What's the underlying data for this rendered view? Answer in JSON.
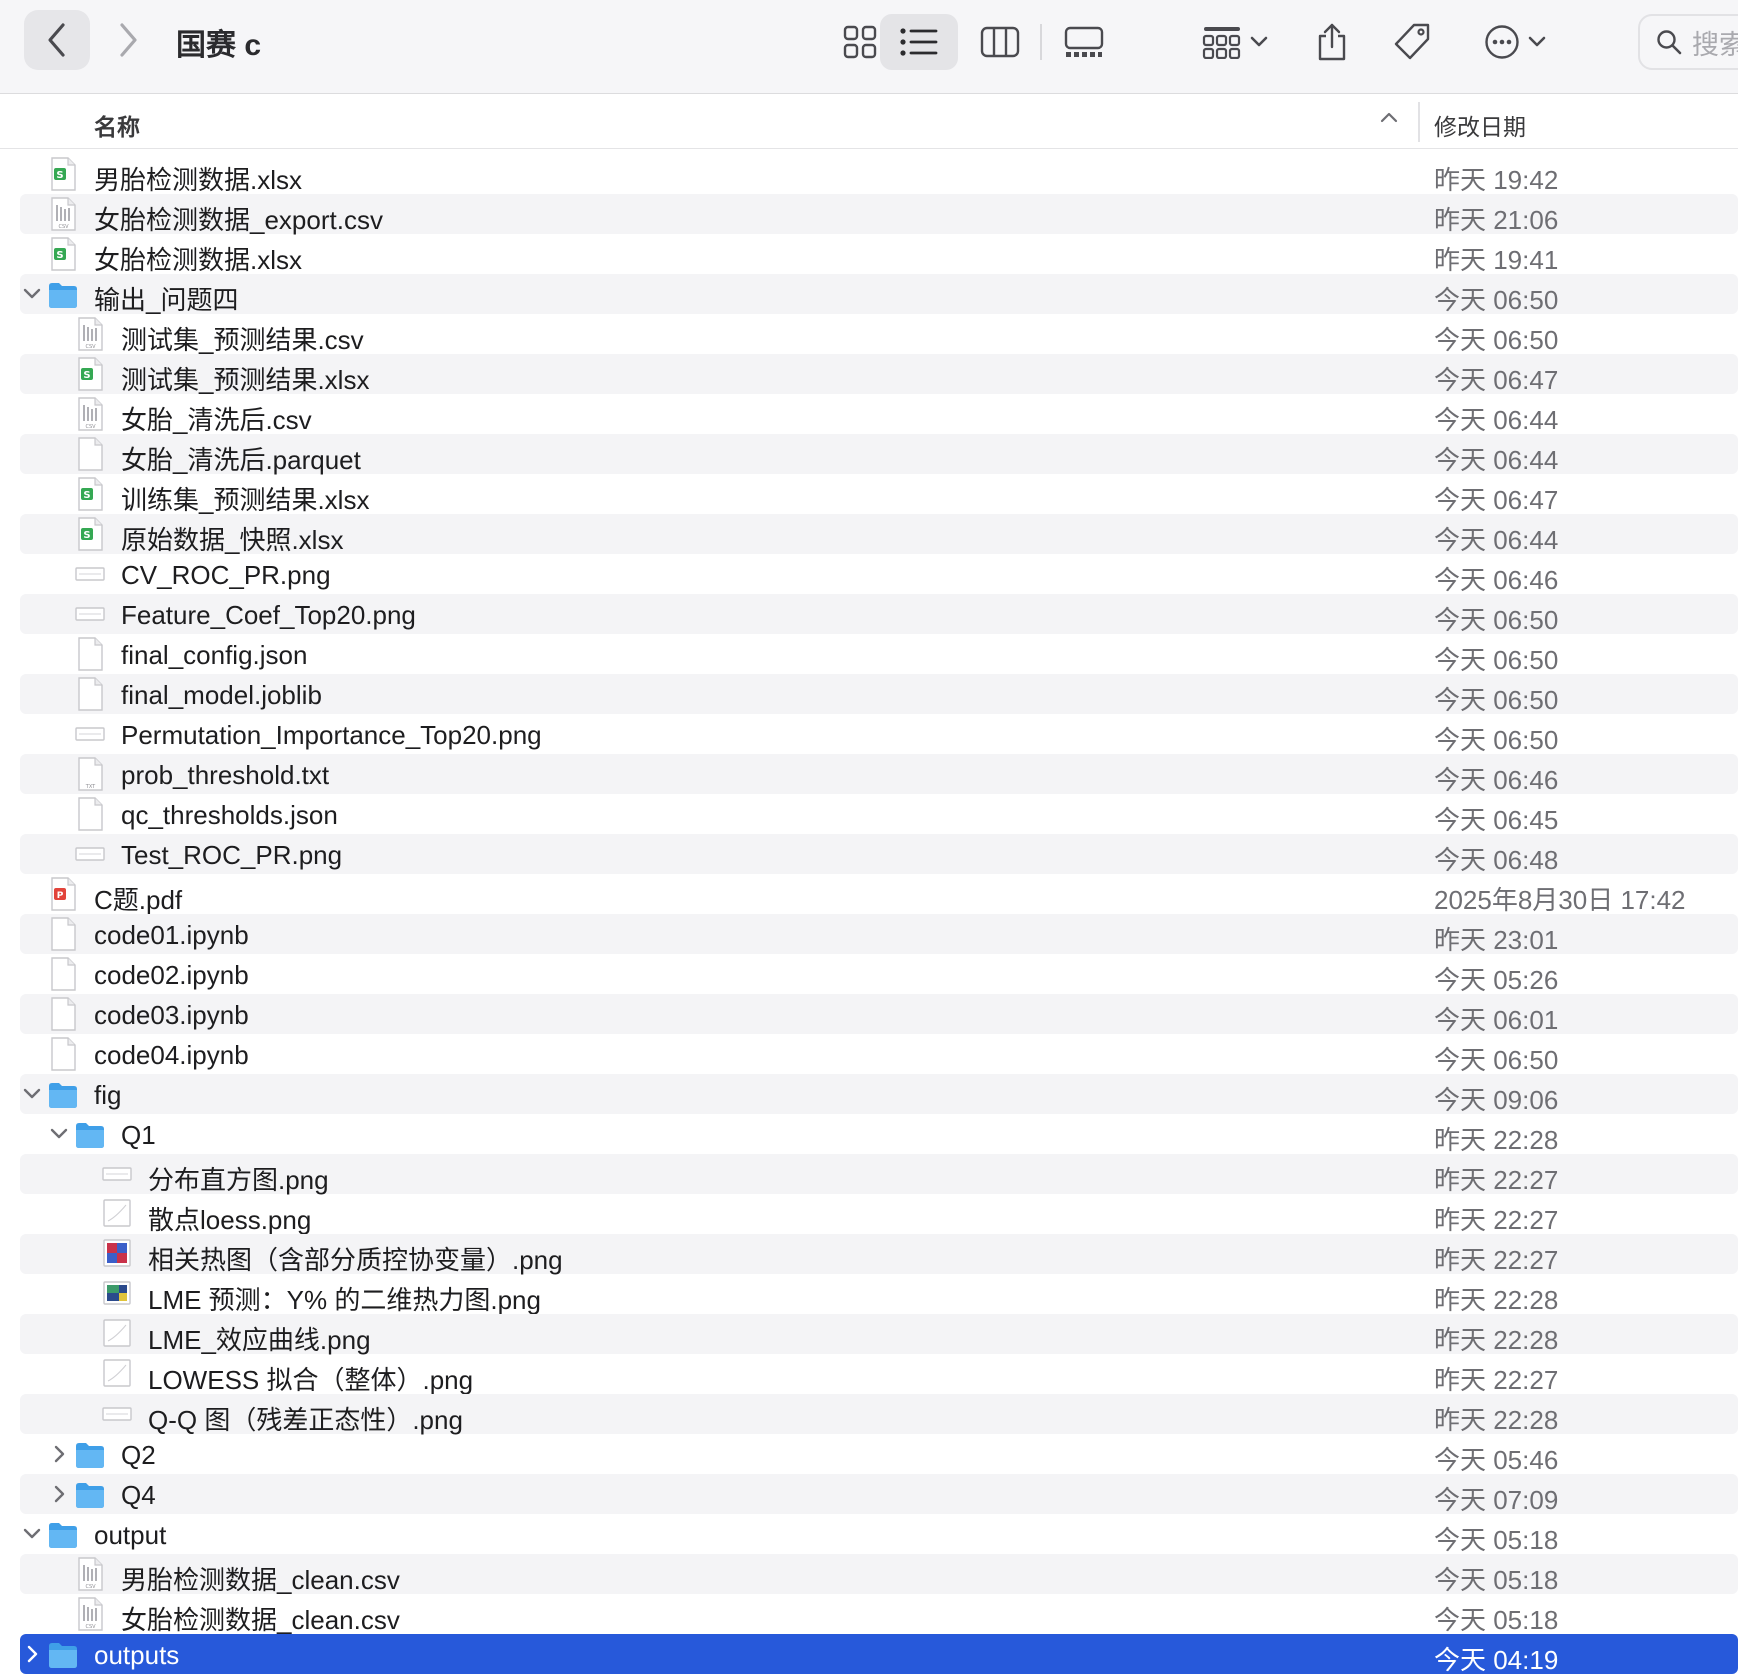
{
  "window": {
    "title": "国赛 c"
  },
  "search": {
    "placeholder": "搜索"
  },
  "header": {
    "name_col": "名称",
    "date_col": "修改日期"
  },
  "rows": [
    {
      "name": "男胎检测数据.xlsx",
      "date": "昨天 19:42",
      "depth": 0,
      "type": "xlsx"
    },
    {
      "name": "女胎检测数据_export.csv",
      "date": "昨天 21:06",
      "depth": 0,
      "type": "csv"
    },
    {
      "name": "女胎检测数据.xlsx",
      "date": "昨天 19:41",
      "depth": 0,
      "type": "xlsx"
    },
    {
      "name": "输出_问题四",
      "date": "今天 06:50",
      "depth": 0,
      "type": "folder",
      "expanded": true
    },
    {
      "name": "测试集_预测结果.csv",
      "date": "今天 06:50",
      "depth": 1,
      "type": "csv"
    },
    {
      "name": "测试集_预测结果.xlsx",
      "date": "今天 06:47",
      "depth": 1,
      "type": "xlsx"
    },
    {
      "name": "女胎_清洗后.csv",
      "date": "今天 06:44",
      "depth": 1,
      "type": "csv"
    },
    {
      "name": "女胎_清洗后.parquet",
      "date": "今天 06:44",
      "depth": 1,
      "type": "generic"
    },
    {
      "name": "训练集_预测结果.xlsx",
      "date": "今天 06:47",
      "depth": 1,
      "type": "xlsx"
    },
    {
      "name": "原始数据_快照.xlsx",
      "date": "今天 06:44",
      "depth": 1,
      "type": "xlsx"
    },
    {
      "name": "CV_ROC_PR.png",
      "date": "今天 06:46",
      "depth": 1,
      "type": "png-wide"
    },
    {
      "name": "Feature_Coef_Top20.png",
      "date": "今天 06:50",
      "depth": 1,
      "type": "png-wide"
    },
    {
      "name": "final_config.json",
      "date": "今天 06:50",
      "depth": 1,
      "type": "generic"
    },
    {
      "name": "final_model.joblib",
      "date": "今天 06:50",
      "depth": 1,
      "type": "generic"
    },
    {
      "name": "Permutation_Importance_Top20.png",
      "date": "今天 06:50",
      "depth": 1,
      "type": "png-wide"
    },
    {
      "name": "prob_threshold.txt",
      "date": "今天 06:46",
      "depth": 1,
      "type": "txt"
    },
    {
      "name": "qc_thresholds.json",
      "date": "今天 06:45",
      "depth": 1,
      "type": "generic"
    },
    {
      "name": "Test_ROC_PR.png",
      "date": "今天 06:48",
      "depth": 1,
      "type": "png-wide"
    },
    {
      "name": "C题.pdf",
      "date": "2025年8月30日 17:42",
      "depth": 0,
      "type": "pdf"
    },
    {
      "name": "code01.ipynb",
      "date": "昨天 23:01",
      "depth": 0,
      "type": "generic"
    },
    {
      "name": "code02.ipynb",
      "date": "今天 05:26",
      "depth": 0,
      "type": "generic"
    },
    {
      "name": "code03.ipynb",
      "date": "今天 06:01",
      "depth": 0,
      "type": "generic"
    },
    {
      "name": "code04.ipynb",
      "date": "今天 06:50",
      "depth": 0,
      "type": "generic"
    },
    {
      "name": "fig",
      "date": "今天 09:06",
      "depth": 0,
      "type": "folder",
      "expanded": true
    },
    {
      "name": "Q1",
      "date": "昨天 22:28",
      "depth": 1,
      "type": "folder",
      "expanded": true
    },
    {
      "name": "分布直方图.png",
      "date": "昨天 22:27",
      "depth": 2,
      "type": "png-wide"
    },
    {
      "name": "散点loess.png",
      "date": "昨天 22:27",
      "depth": 2,
      "type": "png-square"
    },
    {
      "name": "相关热图（含部分质控协变量）.png",
      "date": "昨天 22:27",
      "depth": 2,
      "type": "png-heat"
    },
    {
      "name": "LME 预测：Y% 的二维热力图.png",
      "date": "昨天 22:28",
      "depth": 2,
      "type": "png-dark"
    },
    {
      "name": "LME_效应曲线.png",
      "date": "昨天 22:28",
      "depth": 2,
      "type": "png-square"
    },
    {
      "name": "LOWESS 拟合（整体）.png",
      "date": "昨天 22:27",
      "depth": 2,
      "type": "png-square"
    },
    {
      "name": "Q-Q 图（残差正态性）.png",
      "date": "昨天 22:28",
      "depth": 2,
      "type": "png-wide"
    },
    {
      "name": "Q2",
      "date": "今天 05:46",
      "depth": 1,
      "type": "folder",
      "expanded": false
    },
    {
      "name": "Q4",
      "date": "今天 07:09",
      "depth": 1,
      "type": "folder",
      "expanded": false
    },
    {
      "name": "output",
      "date": "今天 05:18",
      "depth": 0,
      "type": "folder",
      "expanded": true
    },
    {
      "name": "男胎检测数据_clean.csv",
      "date": "今天 05:18",
      "depth": 1,
      "type": "csv"
    },
    {
      "name": "女胎检测数据_clean.csv",
      "date": "今天 05:18",
      "depth": 1,
      "type": "csv"
    },
    {
      "name": "outputs",
      "date": "今天 04:19",
      "depth": 0,
      "type": "folder",
      "expanded": false,
      "selected": true
    }
  ]
}
